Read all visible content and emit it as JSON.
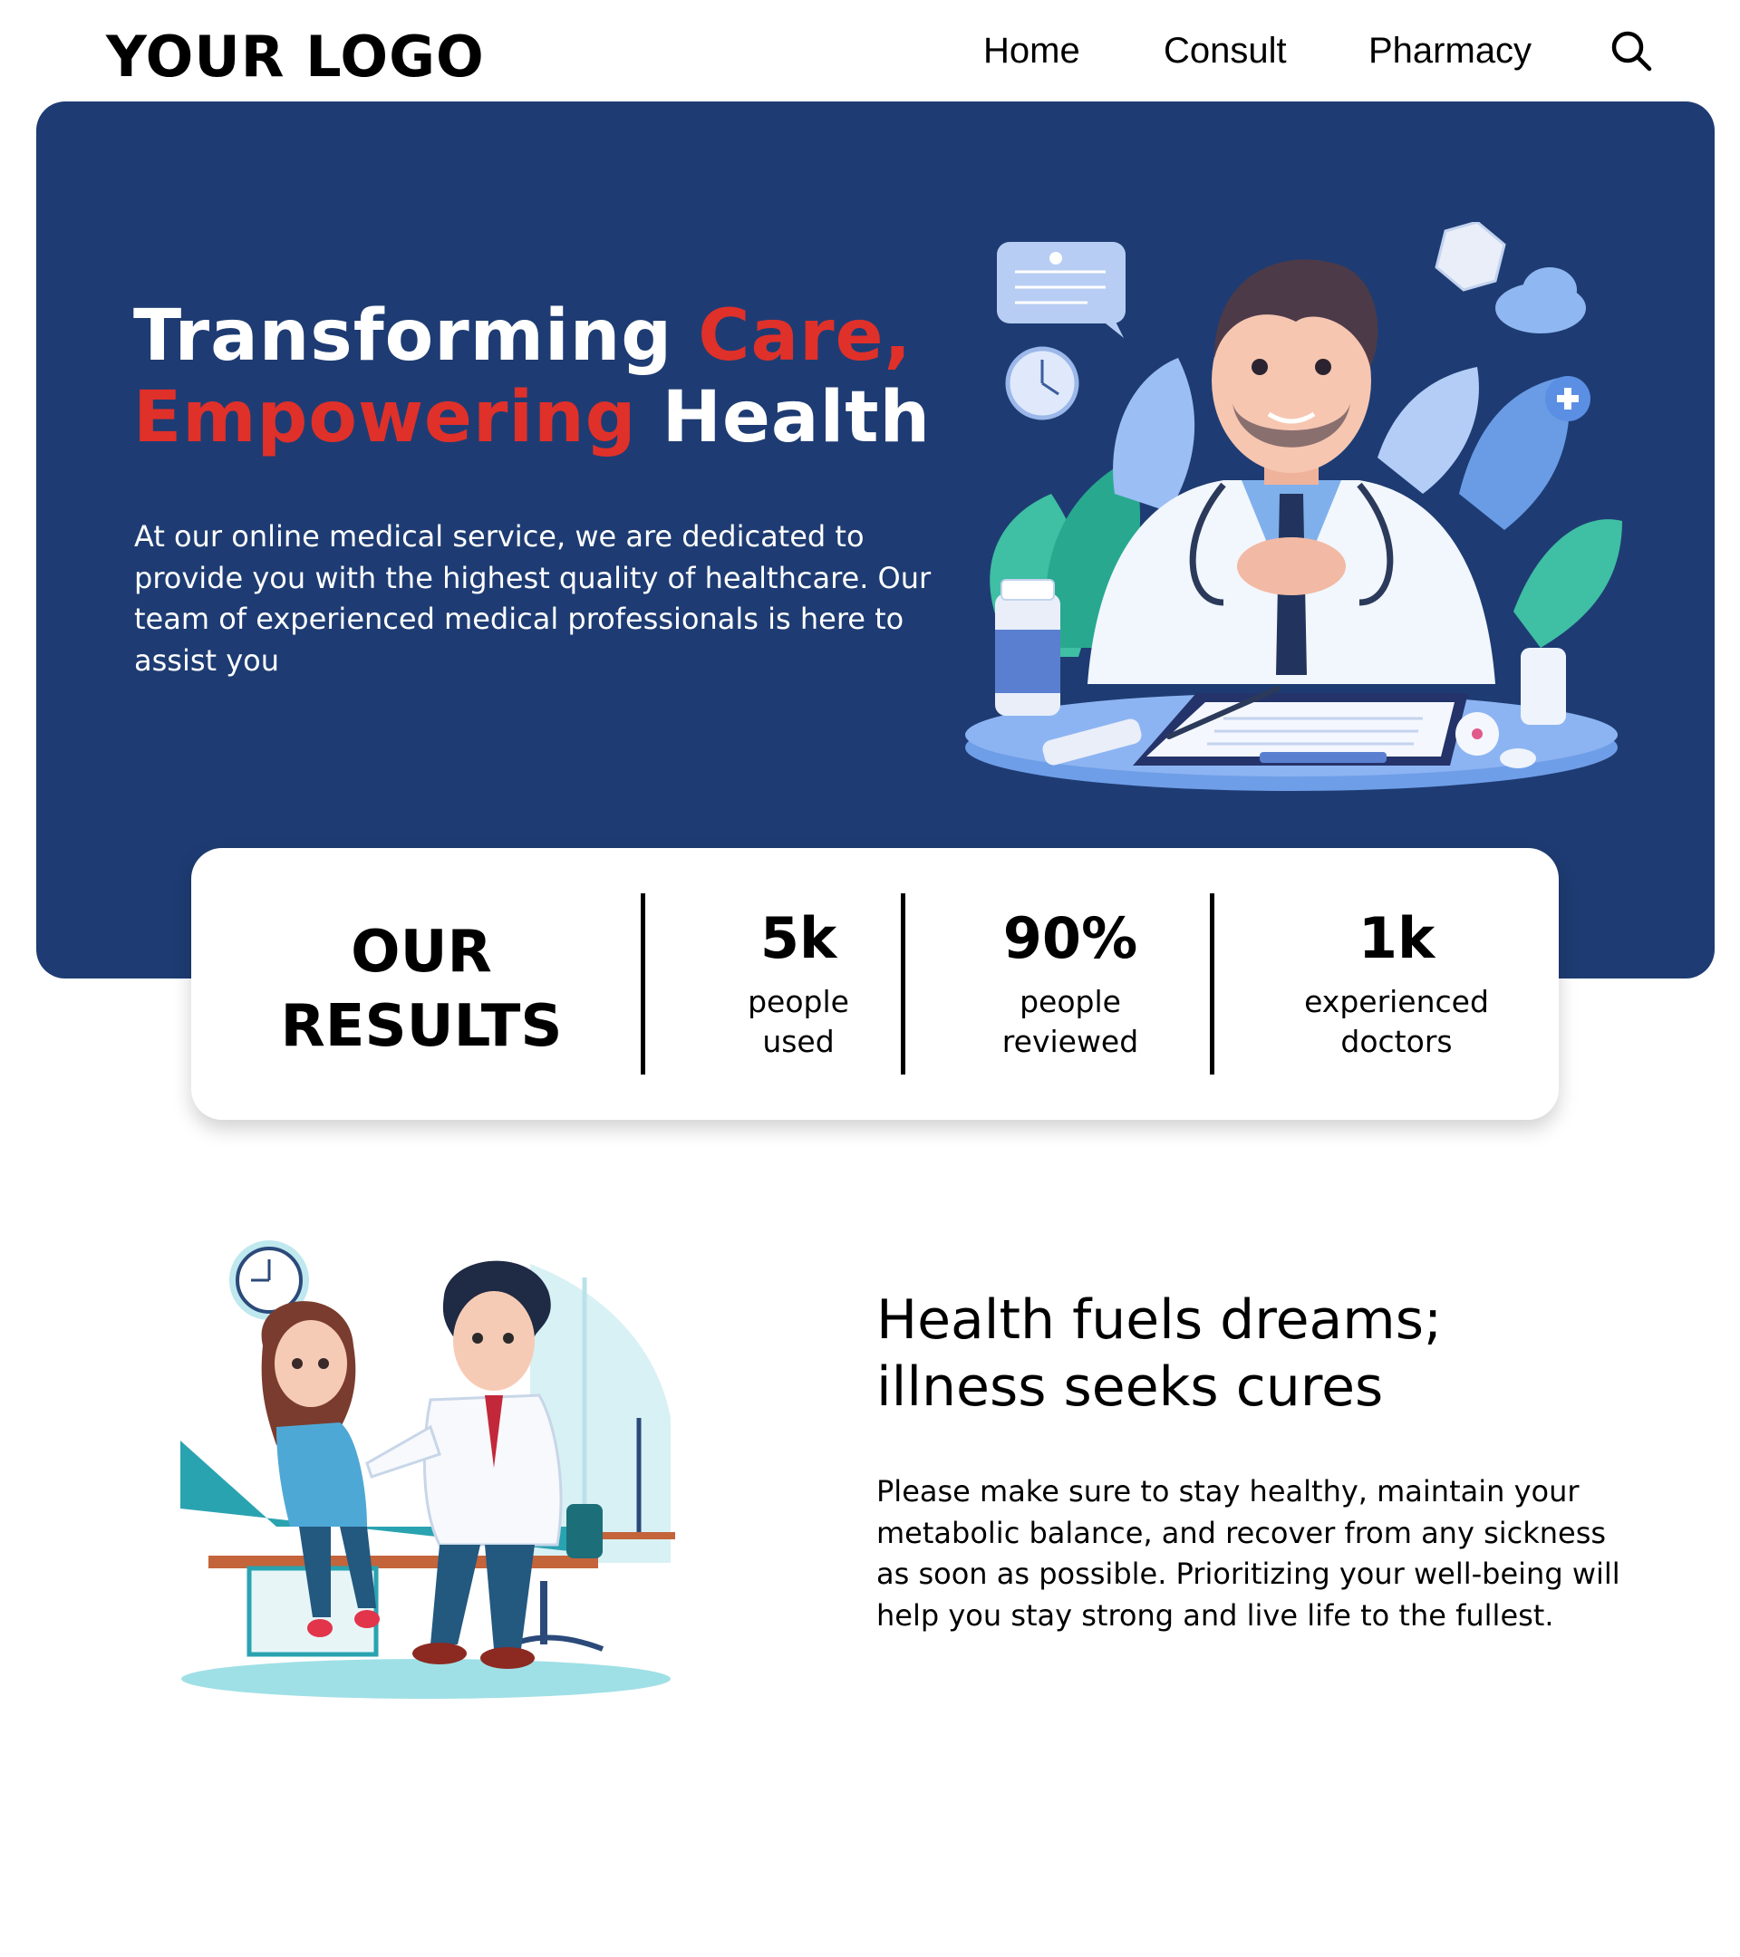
{
  "header": {
    "logo": "YOUR LOGO",
    "nav": [
      {
        "label": "Home"
      },
      {
        "label": "Consult"
      },
      {
        "label": "Pharmacy"
      }
    ],
    "search_icon": "search-icon"
  },
  "hero": {
    "title_part1": "Transforming ",
    "title_part2": "Care,",
    "title_part3": "Empowering",
    "title_part4": " Health",
    "description": "At our online medical service, we are dedicated to provide you with the highest quality of healthcare. Our team of experienced medical professionals is here to assist you",
    "illustration": "doctor-at-desk-illustration"
  },
  "results": {
    "title_line1": "OUR",
    "title_line2": "RESULTS",
    "stats": [
      {
        "value": "5k",
        "label_line1": "people",
        "label_line2": "used"
      },
      {
        "value": "90%",
        "label_line1": "people",
        "label_line2": "reviewed"
      },
      {
        "value": "1k",
        "label_line1": "experienced",
        "label_line2": "doctors"
      }
    ]
  },
  "section": {
    "title_line1": "Health fuels dreams;",
    "title_line2": "illness seeks cures",
    "description": "Please make sure to stay healthy, maintain your metabolic balance, and recover from any sickness as soon as possible. Prioritizing your well-being will help you stay strong and live life to the fullest.",
    "illustration": "doctor-with-patient-illustration"
  },
  "colors": {
    "hero_background": "#1e3c73",
    "accent_red": "#e0302a",
    "text": "#000000",
    "white": "#ffffff"
  }
}
